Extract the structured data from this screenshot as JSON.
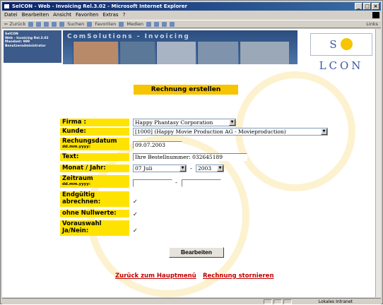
{
  "window": {
    "title": "SelCON - Web - Invoicing Rel.3.02 - Microsoft Internet Explorer",
    "controls": [
      "_",
      "□",
      "×"
    ]
  },
  "menubar": [
    "Datei",
    "Bearbeiten",
    "Ansicht",
    "Favoriten",
    "Extras",
    "?"
  ],
  "toolbar": {
    "back": "⇐ Zurück",
    "search": "Suchen",
    "favorites": "Favoriten",
    "media": "Medien",
    "links": "Links"
  },
  "left_info": {
    "line1": "SelCON",
    "line2": "Web - Invoicing Rel.3.02",
    "line3": "Mandant: 999",
    "line4": "Benutzeradministrator"
  },
  "banner": {
    "title": "ComSolutions - Invoicing",
    "logo_l1": "S",
    "logo_l2": "LCON"
  },
  "form": {
    "heading": "Rechnung erstellen",
    "firma_label": "Firma :",
    "firma_value": "Happy Phantasy Corporation",
    "kunde_label": "Kunde:",
    "kunde_value": "[1000] (Happy Movie Production AG - Movieproduction)",
    "datum_label": "Rechungsdatum",
    "datum_sub": "dd.mm.yyyy:",
    "datum_value": "09.07.2003",
    "text_label": "Text:",
    "text_value": "Ihre Bestellnummer: 032645189",
    "monat_label": "Monat / Jahr:",
    "monat_value": "07 Juli",
    "monat_dash": "-",
    "jahr_value": "2003",
    "zeitraum_label": "Zeitraum",
    "zeitraum_sub": "dd.mm.yyyy:",
    "zeitraum_dash": "-",
    "zeitraum_from": "",
    "zeitraum_to": "",
    "endg_label_l1": "Endgültig",
    "endg_label_l2": "abrechnen:",
    "endg_checked": "✓",
    "null_label": "ohne Nullwerte:",
    "null_checked": "✓",
    "vorauswahl_l1": "Vorauswahl",
    "vorauswahl_l2": "Ja/Nein:",
    "vorauswahl_checked": "✓",
    "submit": "Bearbeiten"
  },
  "links": {
    "back": "Zurück zum Hauptmenü",
    "cancel": "Rechnung stornieren"
  },
  "statusbar": {
    "zone": "Lokales Intranet"
  }
}
